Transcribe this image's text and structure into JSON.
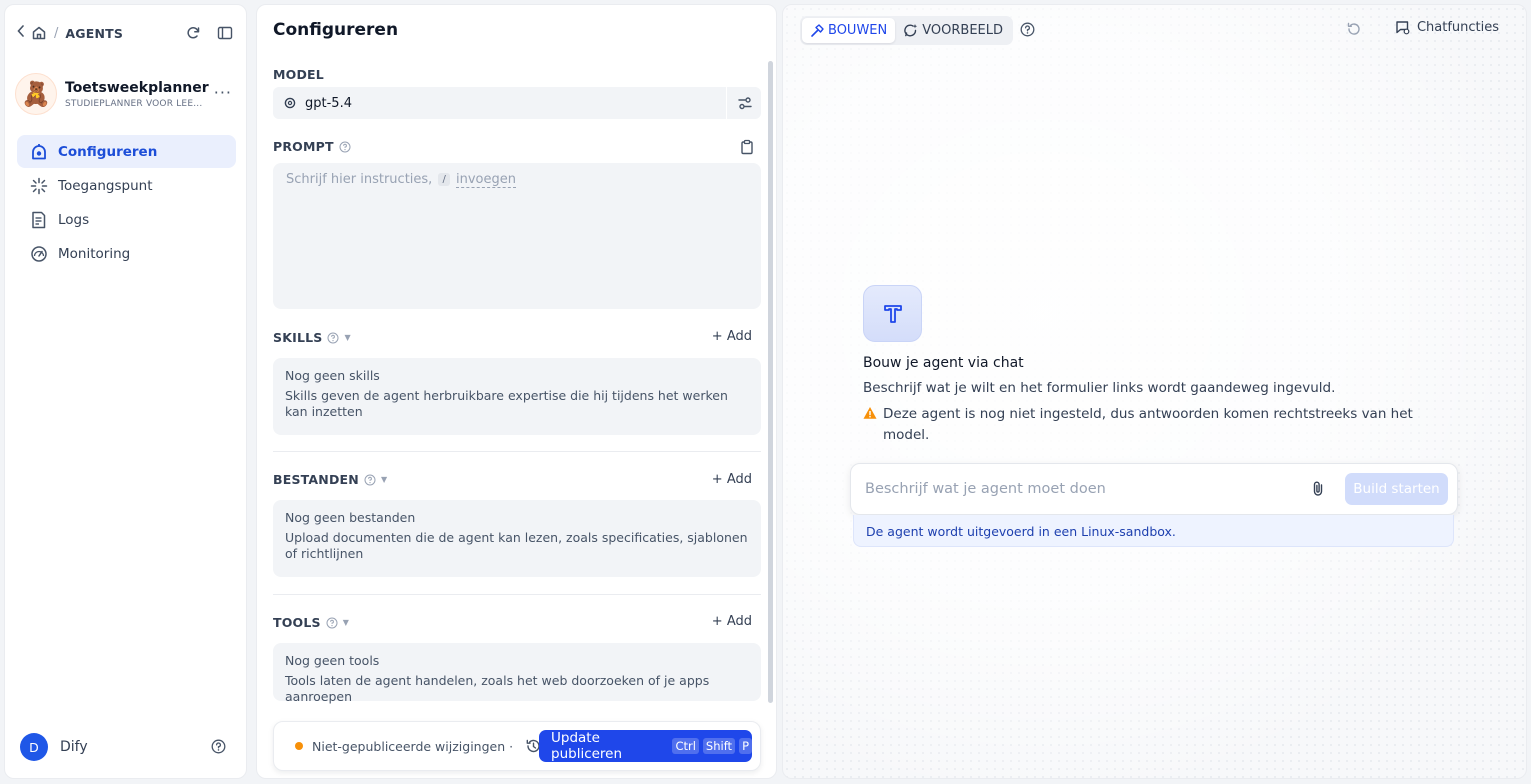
{
  "sidebar": {
    "crumb": "AGENTS",
    "agent_name": "Toetsweekplanner",
    "agent_subtitle": "STUDIEPLANNER VOOR LEE...",
    "nav": [
      {
        "label": "Configureren",
        "icon": "robot-icon",
        "active": true
      },
      {
        "label": "Toegangspunt",
        "icon": "access-point-icon",
        "active": false
      },
      {
        "label": "Logs",
        "icon": "logs-icon",
        "active": false
      },
      {
        "label": "Monitoring",
        "icon": "monitoring-icon",
        "active": false
      }
    ],
    "workspace_initial": "D",
    "workspace_name": "Dify"
  },
  "config": {
    "title": "Configureren",
    "model_label": "MODEL",
    "model_name": "gpt-5.4",
    "prompt_label": "PROMPT",
    "prompt_placeholder_pre": "Schrijf hier instructies,",
    "prompt_slash": "/",
    "prompt_insert": "invoegen",
    "add_label": "+ Add",
    "skills": {
      "label": "SKILLS",
      "empty_title": "Nog geen skills",
      "empty_desc": "Skills geven de agent herbruikbare expertise die hij tijdens het werken kan inzetten"
    },
    "files": {
      "label": "BESTANDEN",
      "empty_title": "Nog geen bestanden",
      "empty_desc": "Upload documenten die de agent kan lezen, zoals specificaties, sjablonen of richtlijnen"
    },
    "tools": {
      "label": "TOOLS",
      "empty_title": "Nog geen tools",
      "empty_desc": "Tools laten de agent handelen, zoals het web doorzoeken of je apps aanroepen"
    },
    "footer": {
      "unpublished": "Niet-gepubliceerde wijzigingen ·",
      "publish_label": "Update publiceren",
      "keys": [
        "Ctrl",
        "Shift",
        "P"
      ]
    }
  },
  "canvas": {
    "tab_build": "BOUWEN",
    "tab_preview": "VOORBEELD",
    "chat_features": "Chatfuncties",
    "build_title": "Bouw je agent via chat",
    "build_desc": "Beschrijf wat je wilt en het formulier links wordt gaandeweg ingevuld.",
    "build_warning": "Deze agent is nog niet ingesteld, dus antwoorden komen rechtstreeks van het model.",
    "input_placeholder": "Beschrijf wat je agent moet doen",
    "start_button": "Build starten",
    "sandbox_note": "De agent wordt uitgevoerd in een Linux-sandbox."
  },
  "colors": {
    "accent": "#1f47ea",
    "active_nav_bg": "#eaeffd",
    "warning": "#f79009"
  }
}
